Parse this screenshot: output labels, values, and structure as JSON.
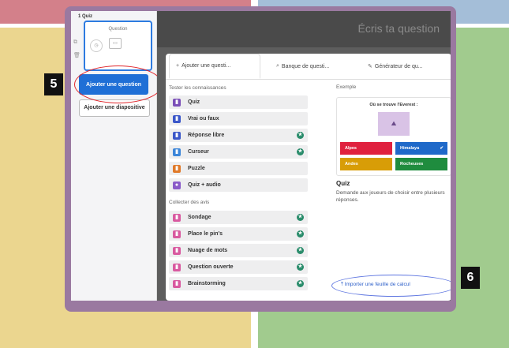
{
  "colors": {
    "quad_top_left": "#d3808a",
    "quad_top_right": "#a4bed8",
    "quad_bottom_left": "#ebd68f",
    "quad_bottom_right": "#a1cb8e",
    "frame": "#9a79a0",
    "accent_blue": "#1f6fd6",
    "annotation_red": "#e0262b",
    "annotation_blue": "#5c74e0"
  },
  "steps": {
    "left_badge": "5",
    "right_badge": "6"
  },
  "sidebar": {
    "slide_label": "1  Quiz",
    "thumb_title": "Question",
    "add_question": "Ajouter une question",
    "add_slide": "Ajouter une diapositive"
  },
  "editor": {
    "question_placeholder": "Écris ta question"
  },
  "tabs": [
    {
      "icon": "plus-icon",
      "label": "Ajouter une questi..."
    },
    {
      "icon": "search-icon",
      "label": "Banque de questi..."
    },
    {
      "icon": "magic-wand-icon",
      "label": "Générateur de qu..."
    }
  ],
  "knowledge": {
    "heading": "Tester les connaissances",
    "items": [
      {
        "label": "Quiz",
        "icon": "quiz-icon",
        "color": "#7b4fb8",
        "premium": false
      },
      {
        "label": "Vrai ou faux",
        "icon": "true-false-icon",
        "color": "#3b57c9",
        "premium": false
      },
      {
        "label": "Réponse libre",
        "icon": "free-answer-icon",
        "color": "#3b57c9",
        "premium": true
      },
      {
        "label": "Curseur",
        "icon": "slider-icon",
        "color": "#3d86d9",
        "premium": true
      },
      {
        "label": "Puzzle",
        "icon": "puzzle-icon",
        "color": "#e07a2a",
        "premium": false
      },
      {
        "label": "Quiz + audio",
        "icon": "audio-icon",
        "color": "#8a5bc9",
        "premium": false
      }
    ]
  },
  "feedback": {
    "heading": "Collecter des avis",
    "items": [
      {
        "label": "Sondage",
        "icon": "poll-icon",
        "color": "#d95aa0",
        "premium": true
      },
      {
        "label": "Place le pin's",
        "icon": "pin-icon",
        "color": "#d95aa0",
        "premium": true
      },
      {
        "label": "Nuage de mots",
        "icon": "word-cloud-icon",
        "color": "#d95aa0",
        "premium": true
      },
      {
        "label": "Question ouverte",
        "icon": "open-question-icon",
        "color": "#d95aa0",
        "premium": true
      },
      {
        "label": "Brainstorming",
        "icon": "brainstorm-icon",
        "color": "#d95aa0",
        "premium": true
      }
    ]
  },
  "example": {
    "label": "Exemple",
    "question": "Où se trouve l'Everest :",
    "answers": [
      "Alpes",
      "Himalaya",
      "Andes",
      "Rocheuses"
    ],
    "correct_mark": "✔",
    "title": "Quiz",
    "description": "Demande aux joueurs de choisir entre plusieurs réponses."
  },
  "import_link": "Importer une feuille de calcul"
}
